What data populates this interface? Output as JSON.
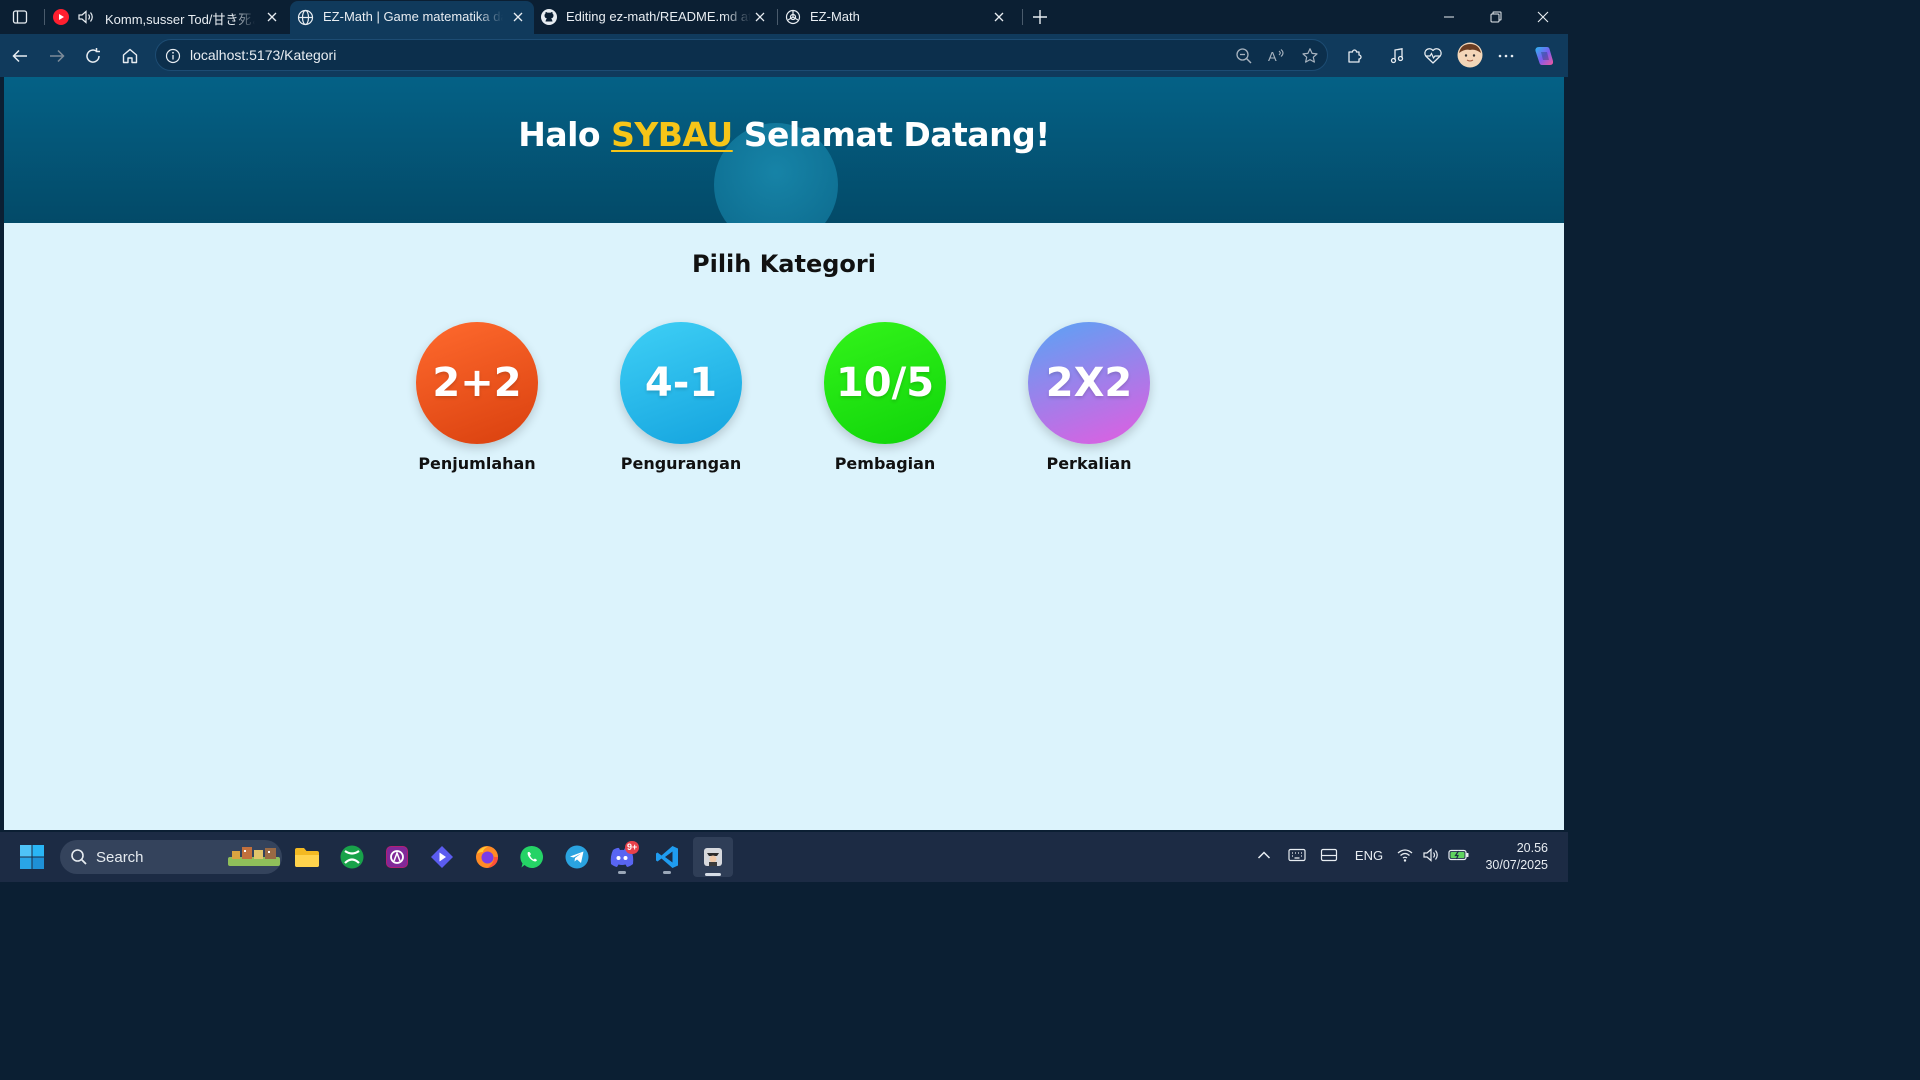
{
  "browser": {
    "tabs": [
      {
        "title": "Komm,susser Tod/甘き死よ、来",
        "active": false,
        "icon": "youtube-music-icon",
        "audio": true
      },
      {
        "title": "EZ-Math | Game matematika dasar",
        "active": true,
        "icon": "globe-icon"
      },
      {
        "title": "Editing ez-math/README.md at main",
        "active": false,
        "icon": "github-icon"
      },
      {
        "title": "EZ-Math",
        "active": false,
        "icon": "openai-icon"
      }
    ],
    "url": "localhost:5173/Kategori"
  },
  "page": {
    "greeting_prefix": "Halo ",
    "username": "SYBAU",
    "greeting_suffix": " Selamat Datang!",
    "section_title": "Pilih Kategori",
    "categories": [
      {
        "symbol": "2+2",
        "label": "Penjumlahan",
        "gradient_from": "#ff6a2e",
        "gradient_to": "#d9400e"
      },
      {
        "symbol": "4-1",
        "label": "Pengurangan",
        "gradient_from": "#3fd0f6",
        "gradient_to": "#14a3de"
      },
      {
        "symbol": "10/5",
        "label": "Pembagian",
        "gradient_from": "#33f41a",
        "gradient_to": "#10d40a"
      },
      {
        "symbol": "2X2",
        "label": "Perkalian",
        "gradient_from": "#58a4f5",
        "gradient_to": "#e35ce0"
      }
    ]
  },
  "taskbar": {
    "search_label": "Search",
    "language": "ENG",
    "time": "20.56",
    "date": "30/07/2025",
    "discord_badge": "9+"
  },
  "colors": {
    "hero_top": "#046186",
    "hero_bottom": "#034a68",
    "page_bg": "#dcf3fc",
    "username_accent": "#f6c518"
  }
}
